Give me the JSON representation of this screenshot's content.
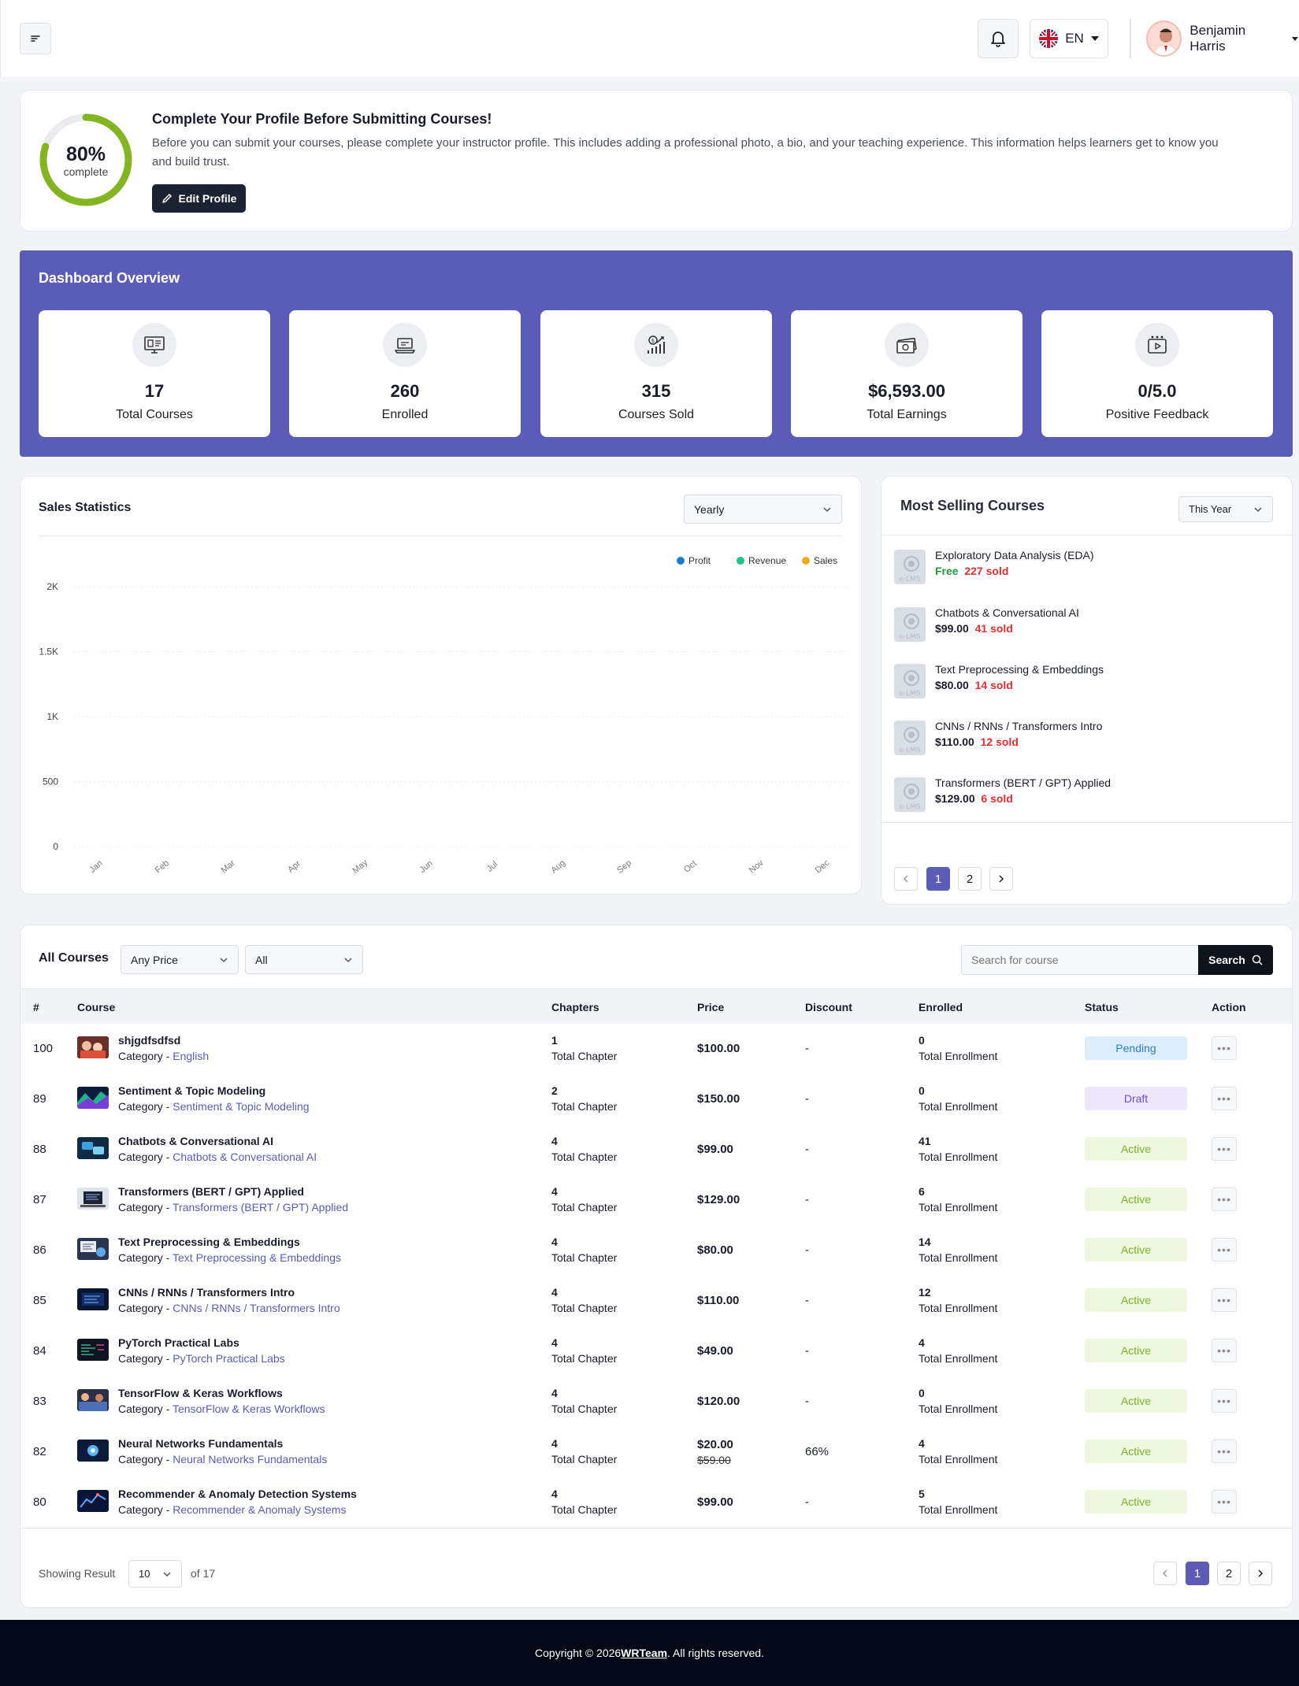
{
  "header": {
    "language": "EN",
    "user_name": "Benjamin Harris"
  },
  "profile_card": {
    "percent": "80%",
    "percent_value": 80,
    "percent_label": "complete",
    "title": "Complete Your Profile Before Submitting Courses!",
    "description": "Before you can submit your courses, please complete your instructor profile. This includes adding a professional photo, a bio, and your teaching experience. This information helps learners get to know you and build trust.",
    "edit_button": "Edit Profile"
  },
  "overview": {
    "title": "Dashboard Overview",
    "stats": [
      {
        "value": "17",
        "label": "Total Courses",
        "icon": "monitor-course-icon"
      },
      {
        "value": "260",
        "label": "Enrolled",
        "icon": "laptop-enrolled-icon"
      },
      {
        "value": "315",
        "label": "Courses Sold",
        "icon": "sales-growth-icon"
      },
      {
        "value": "$6,593.00",
        "label": "Total Earnings",
        "icon": "cash-icon"
      },
      {
        "value": "0/5.0",
        "label": "Positive Feedback",
        "icon": "video-feedback-icon"
      }
    ]
  },
  "sales": {
    "title": "Sales Statistics",
    "period": "Yearly"
  },
  "chart_data": {
    "type": "line",
    "categories": [
      "Jan",
      "Feb",
      "Mar",
      "Apr",
      "May",
      "Jun",
      "Jul",
      "Aug",
      "Sep",
      "Oct",
      "Nov",
      "Dec"
    ],
    "y_ticks": [
      "2K",
      "1.5K",
      "1K",
      "500",
      "0"
    ],
    "ylim": [
      0,
      2000
    ],
    "legend_position": "top-right",
    "series": [
      {
        "name": "Profit",
        "color": "#1c7ed6",
        "values": [
          0,
          0,
          0,
          0,
          0,
          0,
          0,
          0,
          0,
          0,
          0,
          0
        ]
      },
      {
        "name": "Revenue",
        "color": "#22c08b",
        "values": [
          0,
          0,
          0,
          0,
          0,
          0,
          0,
          0,
          0,
          0,
          0,
          0
        ]
      },
      {
        "name": "Sales",
        "color": "#f5a623",
        "values": [
          0,
          0,
          0,
          0,
          0,
          0,
          0,
          0,
          0,
          0,
          0,
          0
        ]
      }
    ]
  },
  "most_selling": {
    "title": "Most Selling Courses",
    "period": "This Year",
    "courses": [
      {
        "name": "Exploratory Data Analysis (EDA)",
        "price": "Free",
        "sold": "227 sold"
      },
      {
        "name": "Chatbots & Conversational AI",
        "price": "$99.00",
        "sold": "41 sold"
      },
      {
        "name": "Text Preprocessing & Embeddings",
        "price": "$80.00",
        "sold": "14 sold"
      },
      {
        "name": "CNNs / RNNs / Transformers Intro",
        "price": "$110.00",
        "sold": "12 sold"
      },
      {
        "name": "Transformers (BERT / GPT) Applied",
        "price": "$129.00",
        "sold": "6 sold"
      }
    ],
    "pages": [
      "1",
      "2"
    ]
  },
  "all_courses": {
    "title": "All Courses",
    "price_filter": "Any Price",
    "status_filter": "All",
    "search_placeholder": "Search for course",
    "search_button": "Search",
    "columns": [
      "#",
      "Course",
      "Chapters",
      "Price",
      "Discount",
      "Enrolled",
      "Status",
      "Action"
    ],
    "category_prefix": "Category - ",
    "chapter_label": "Total Chapter",
    "enroll_label": "Total Enrollment",
    "rows": [
      {
        "num": "100",
        "name": "shjgdfsdfsd",
        "category": "English",
        "chapters": "1",
        "price": "$100.00",
        "old_price": "",
        "discount": "-",
        "enrolled": "0",
        "status": "Pending"
      },
      {
        "num": "89",
        "name": "Sentiment & Topic Modeling",
        "category": "Sentiment & Topic Modeling",
        "chapters": "2",
        "price": "$150.00",
        "old_price": "",
        "discount": "-",
        "enrolled": "0",
        "status": "Draft"
      },
      {
        "num": "88",
        "name": "Chatbots & Conversational AI",
        "category": "Chatbots & Conversational AI",
        "chapters": "4",
        "price": "$99.00",
        "old_price": "",
        "discount": "-",
        "enrolled": "41",
        "status": "Active"
      },
      {
        "num": "87",
        "name": "Transformers (BERT / GPT) Applied",
        "category": "Transformers (BERT / GPT) Applied",
        "chapters": "4",
        "price": "$129.00",
        "old_price": "",
        "discount": "-",
        "enrolled": "6",
        "status": "Active"
      },
      {
        "num": "86",
        "name": "Text Preprocessing & Embeddings",
        "category": "Text Preprocessing & Embeddings",
        "chapters": "4",
        "price": "$80.00",
        "old_price": "",
        "discount": "-",
        "enrolled": "14",
        "status": "Active"
      },
      {
        "num": "85",
        "name": "CNNs / RNNs / Transformers Intro",
        "category": "CNNs / RNNs / Transformers Intro",
        "chapters": "4",
        "price": "$110.00",
        "old_price": "",
        "discount": "-",
        "enrolled": "12",
        "status": "Active"
      },
      {
        "num": "84",
        "name": "PyTorch Practical Labs",
        "category": "PyTorch Practical Labs",
        "chapters": "4",
        "price": "$49.00",
        "old_price": "",
        "discount": "-",
        "enrolled": "4",
        "status": "Active"
      },
      {
        "num": "83",
        "name": "TensorFlow & Keras Workflows",
        "category": "TensorFlow & Keras Workflows",
        "chapters": "4",
        "price": "$120.00",
        "old_price": "",
        "discount": "-",
        "enrolled": "0",
        "status": "Active"
      },
      {
        "num": "82",
        "name": "Neural Networks Fundamentals",
        "category": "Neural Networks Fundamentals",
        "chapters": "4",
        "price": "$20.00",
        "old_price": "$59.00",
        "discount": "66%",
        "enrolled": "4",
        "status": "Active"
      },
      {
        "num": "80",
        "name": "Recommender & Anomaly Detection Systems",
        "category": "Recommender & Anomaly Systems",
        "chapters": "4",
        "price": "$99.00",
        "old_price": "",
        "discount": "-",
        "enrolled": "5",
        "status": "Active"
      }
    ],
    "showing_label": "Showing Result",
    "page_size": "10",
    "total_label": "of 17",
    "pages": [
      "1",
      "2"
    ]
  },
  "footer": {
    "prefix": "Copyright © 2026 ",
    "brand": "WRTeam",
    "suffix": ". All rights reserved."
  },
  "colors": {
    "accent": "#5b5cb8",
    "progress_ring": "#82b51f",
    "sold_red": "#e52f2f",
    "free_green": "#1d9b3c",
    "footer_bg": "#050917"
  }
}
